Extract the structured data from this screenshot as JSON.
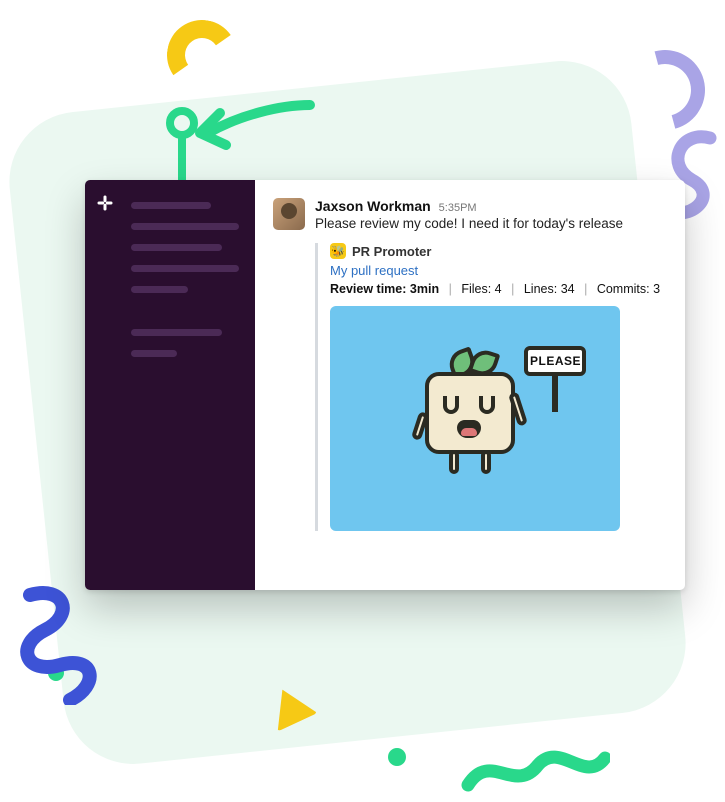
{
  "message": {
    "author": "Jaxson Workman",
    "time": "5:35PM",
    "text": "Please review my code! I need it for today's release"
  },
  "attachment": {
    "app_emoji": "🐝",
    "app_name": "PR Promoter",
    "link_text": "My pull request",
    "review_label": "Review time:",
    "review_value": "3min",
    "files_label": "Files:",
    "files_value": "4",
    "lines_label": "Lines:",
    "lines_value": "34",
    "commits_label": "Commits:",
    "commits_value": "3",
    "sign_text": "PLEASE"
  }
}
